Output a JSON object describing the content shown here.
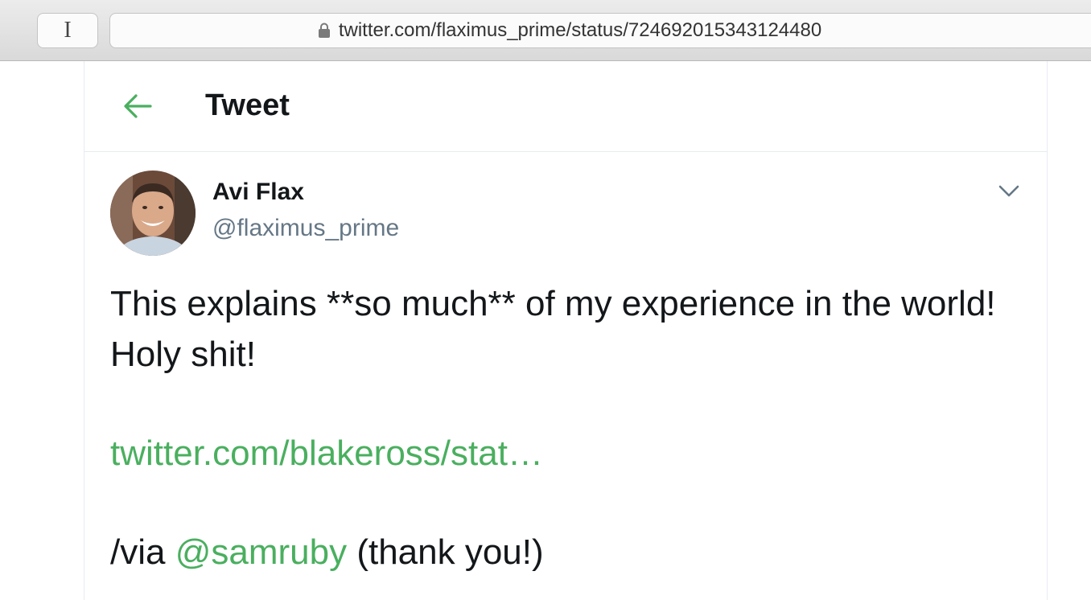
{
  "browser": {
    "reader_label": "I",
    "url": "twitter.com/flaximus_prime/status/724692015343124480"
  },
  "header": {
    "title": "Tweet"
  },
  "tweet": {
    "author_name": "Avi Flax",
    "author_handle": "@flaximus_prime",
    "text_line1": "This explains **so much** of my experience in the world! Holy shit!",
    "link_text": "twitter.com/blakeross/stat…",
    "via_prefix": "/via ",
    "via_mention": "@samruby",
    "via_suffix": " (thank you!)"
  },
  "colors": {
    "accent": "#4aaf5f",
    "text": "#14171a",
    "secondary": "#657786"
  }
}
